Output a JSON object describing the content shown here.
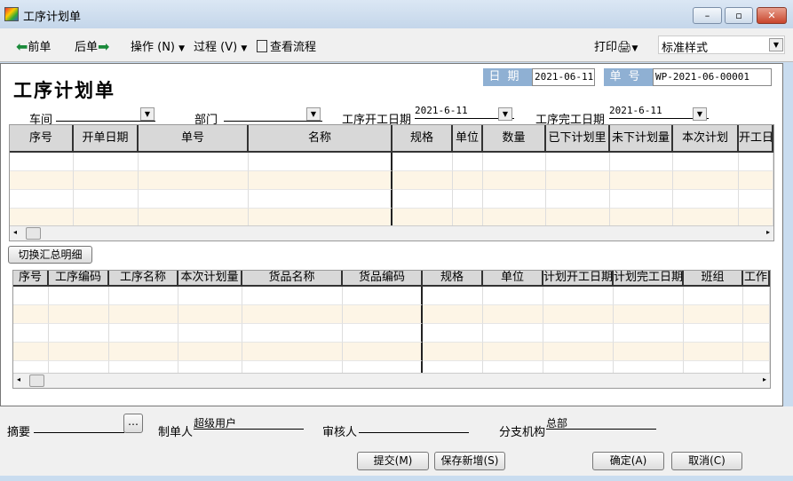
{
  "window": {
    "title": "工序计划单",
    "minimize": "–",
    "maximize": "▫",
    "close": "✕"
  },
  "toolbar": {
    "prev": "前单",
    "next": "后单",
    "operate": "操作 (N)",
    "process": "过程 (V)",
    "view_flow": "查看流程",
    "print": "打印",
    "style_select": "标准样式"
  },
  "header": {
    "doc_title": "工序计划单",
    "date_label": "日期",
    "date_value": "2021-06-11",
    "no_label": "单号",
    "no_value": "WP-2021-06-00001"
  },
  "filters": {
    "workshop_label": "车间",
    "workshop_value": "",
    "dept_label": "部门",
    "dept_value": "",
    "start_label": "工序开工日期",
    "start_value": "2021-6-11",
    "end_label": "工序完工日期",
    "end_value": "2021-6-11"
  },
  "grid1": {
    "columns": [
      "序号",
      "开单日期",
      "单号",
      "名称",
      "规格",
      "单位",
      "数量",
      "已下计划里",
      "未下计划量",
      "本次计划",
      "开工日"
    ],
    "row_count": 4
  },
  "switch_button": "切换汇总明细",
  "grid2": {
    "columns": [
      "序号",
      "工序编码",
      "工序名称",
      "本次计划量",
      "货品名称",
      "货品编码",
      "规格",
      "单位",
      "计划开工日期",
      "计划完工日期",
      "班组",
      "工作"
    ],
    "row_count": 4
  },
  "footer": {
    "summary_label": "摘要",
    "summary_value": "",
    "ellipsis": "…",
    "maker_label": "制单人",
    "maker_value": "超级用户",
    "auditor_label": "审核人",
    "auditor_value": "",
    "branch_label": "分支机构",
    "branch_value": "总部"
  },
  "buttons": {
    "submit": "提交(M)",
    "save_new": "保存新增(S)",
    "ok": "确定(A)",
    "cancel": "取消(C)"
  },
  "colors": {
    "alt_row": "#fdf5e6",
    "label_blue": "#8fb0d3"
  }
}
